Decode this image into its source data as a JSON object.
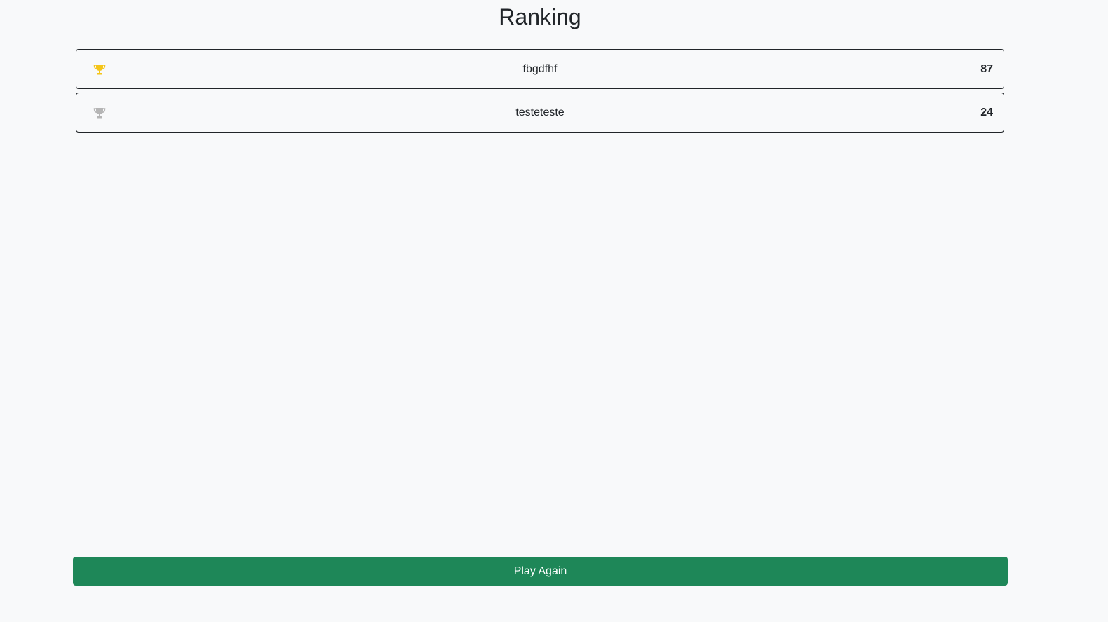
{
  "page": {
    "title": "Ranking"
  },
  "ranking": [
    {
      "icon": "trophy-icon",
      "icon_color": "#f5c518",
      "name": "fbgdfhf",
      "score": "87"
    },
    {
      "icon": "trophy-icon",
      "icon_color": "#b5b5b5",
      "name": "testeteste",
      "score": "24"
    }
  ],
  "actions": {
    "play_again_label": "Play Again"
  },
  "colors": {
    "background": "#f8f9fa",
    "button": "#1e8758",
    "border": "#212529"
  }
}
